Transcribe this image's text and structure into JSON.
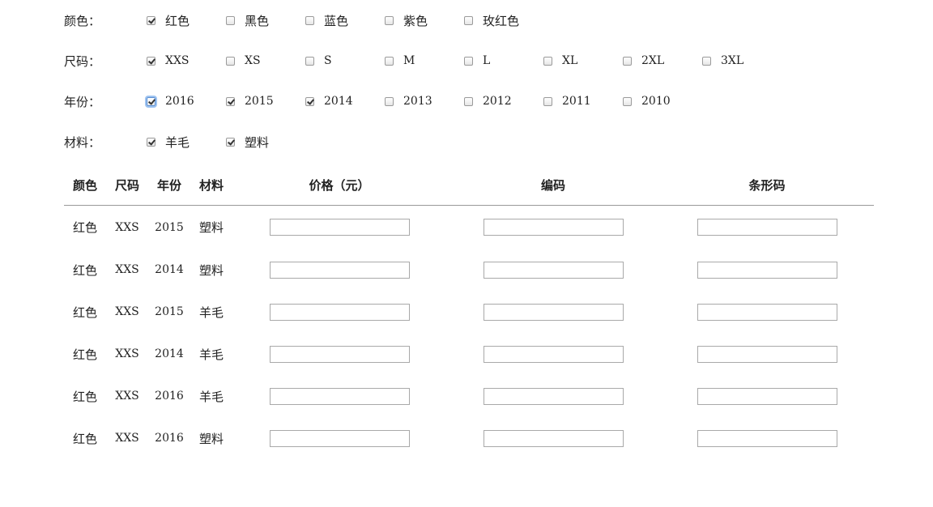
{
  "filters": {
    "color": {
      "label": "颜色：",
      "options": [
        {
          "label": "红色",
          "checked": true
        },
        {
          "label": "黑色",
          "checked": false
        },
        {
          "label": "蓝色",
          "checked": false
        },
        {
          "label": "紫色",
          "checked": false
        },
        {
          "label": "玫红色",
          "checked": false
        }
      ]
    },
    "size": {
      "label": "尺码：",
      "options": [
        {
          "label": "XXS",
          "checked": true
        },
        {
          "label": "XS",
          "checked": false
        },
        {
          "label": "S",
          "checked": false
        },
        {
          "label": "M",
          "checked": false
        },
        {
          "label": "L",
          "checked": false
        },
        {
          "label": "XL",
          "checked": false
        },
        {
          "label": "2XL",
          "checked": false
        },
        {
          "label": "3XL",
          "checked": false
        }
      ]
    },
    "year": {
      "label": "年份：",
      "options": [
        {
          "label": "2016",
          "checked": true
        },
        {
          "label": "2015",
          "checked": true
        },
        {
          "label": "2014",
          "checked": true
        },
        {
          "label": "2013",
          "checked": false
        },
        {
          "label": "2012",
          "checked": false
        },
        {
          "label": "2011",
          "checked": false
        },
        {
          "label": "2010",
          "checked": false
        }
      ]
    },
    "material": {
      "label": "材料：",
      "options": [
        {
          "label": "羊毛",
          "checked": true
        },
        {
          "label": "塑料",
          "checked": true
        }
      ]
    }
  },
  "table": {
    "headers": {
      "color": "颜色",
      "size": "尺码",
      "year": "年份",
      "material": "材料",
      "price": "价格（元）",
      "code": "编码",
      "barcode": "条形码"
    },
    "rows": [
      {
        "color": "红色",
        "size": "XXS",
        "year": "2015",
        "material": "塑料",
        "price": "",
        "code": "",
        "barcode": ""
      },
      {
        "color": "红色",
        "size": "XXS",
        "year": "2014",
        "material": "塑料",
        "price": "",
        "code": "",
        "barcode": ""
      },
      {
        "color": "红色",
        "size": "XXS",
        "year": "2015",
        "material": "羊毛",
        "price": "",
        "code": "",
        "barcode": ""
      },
      {
        "color": "红色",
        "size": "XXS",
        "year": "2014",
        "material": "羊毛",
        "price": "",
        "code": "",
        "barcode": ""
      },
      {
        "color": "红色",
        "size": "XXS",
        "year": "2016",
        "material": "羊毛",
        "price": "",
        "code": "",
        "barcode": ""
      },
      {
        "color": "红色",
        "size": "XXS",
        "year": "2016",
        "material": "塑料",
        "price": "",
        "code": "",
        "barcode": ""
      }
    ]
  }
}
